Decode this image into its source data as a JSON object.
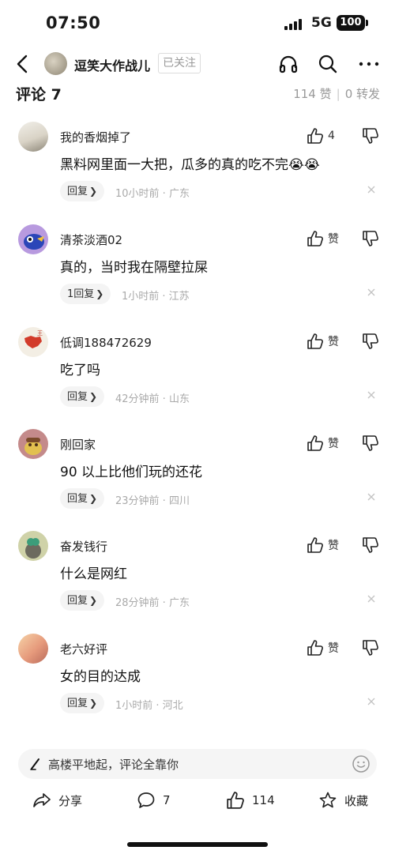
{
  "status_bar": {
    "time": "07:50",
    "network": "5G",
    "battery": "100"
  },
  "header": {
    "channel_name": "逗笑大作战儿",
    "follow_label": "已关注"
  },
  "comments_header": {
    "title": "评论 7",
    "likes": "114 赞",
    "shares": "0 转发"
  },
  "comments": [
    {
      "name": "我的香烟掉了",
      "like_label": "4",
      "text": "黑料网里面一大把，瓜多的真的吃不完😭😭",
      "reply_label": "回复",
      "time": "10小时前",
      "location": "广东",
      "meta": "10小时前 · 广东"
    },
    {
      "name": "清茶淡酒02",
      "like_label": "赞",
      "text": "真的，当时我在隔壁拉屎",
      "reply_label": "1回复",
      "time": "1小时前",
      "location": "江苏",
      "meta": "1小时前 · 江苏"
    },
    {
      "name": "低调188472629",
      "like_label": "赞",
      "text": "吃了吗",
      "reply_label": "回复",
      "time": "42分钟前",
      "location": "山东",
      "meta": "42分钟前 · 山东"
    },
    {
      "name": "刚回家",
      "like_label": "赞",
      "text": "90 以上比他们玩的还花",
      "reply_label": "回复",
      "time": "23分钟前",
      "location": "四川",
      "meta": "23分钟前 · 四川"
    },
    {
      "name": "奋发钱行",
      "like_label": "赞",
      "text": "什么是网红",
      "reply_label": "回复",
      "time": "28分钟前",
      "location": "广东",
      "meta": "28分钟前 · 广东"
    },
    {
      "name": "老六好评",
      "like_label": "赞",
      "text": "女的目的达成",
      "reply_label": "回复",
      "time": "1小时前",
      "location": "河北",
      "meta": "1小时前 · 河北"
    }
  ],
  "input": {
    "placeholder": "高楼平地起，评论全靠你"
  },
  "actions": {
    "share": "分享",
    "comment_count": "7",
    "like_count": "114",
    "favorite": "收藏"
  },
  "icons": {
    "back": "back-chevron-icon",
    "listen": "headphones-icon",
    "search": "search-icon",
    "more": "more-icon",
    "like": "thumb-up-icon",
    "dislike": "thumb-down-icon",
    "close": "close-icon",
    "pen": "pen-icon",
    "emoji": "emoji-icon",
    "share": "share-icon",
    "comment": "comment-icon",
    "favorite": "star-icon"
  }
}
